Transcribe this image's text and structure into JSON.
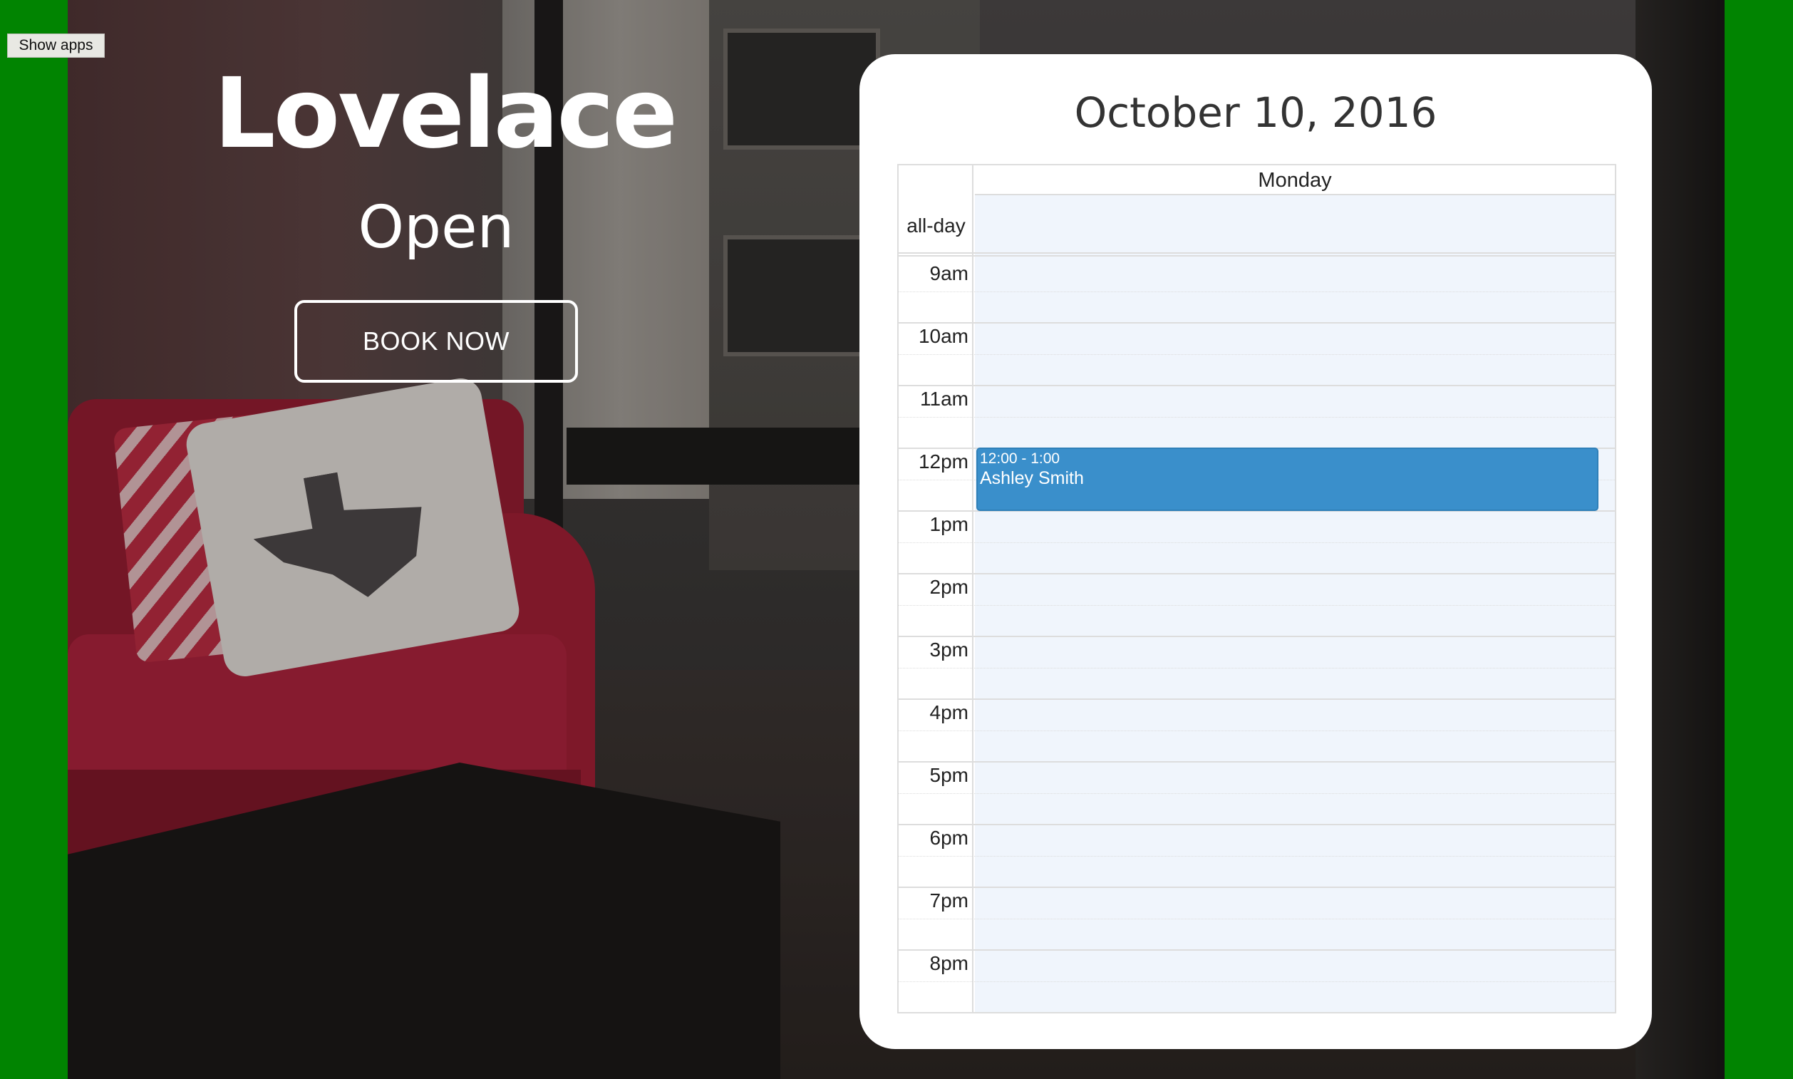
{
  "toolbar": {
    "show_apps_label": "Show apps"
  },
  "room": {
    "name": "Lovelace",
    "status": "Open",
    "book_button_label": "BOOK NOW"
  },
  "calendar": {
    "date_title": "October 10, 2016",
    "day_header": "Monday",
    "all_day_label": "all-day",
    "hours": [
      "9am",
      "10am",
      "11am",
      "12pm",
      "1pm",
      "2pm",
      "3pm",
      "4pm",
      "5pm",
      "6pm",
      "7pm",
      "8pm"
    ],
    "events": [
      {
        "time": "12:00 - 1:00",
        "title": "Ashley Smith",
        "color": "#3a8fcb"
      }
    ]
  },
  "colors": {
    "page_background": "#018401",
    "card_background": "#ffffff",
    "slot_background": "#f0f5fc",
    "event_blue": "#3a8fcb"
  }
}
